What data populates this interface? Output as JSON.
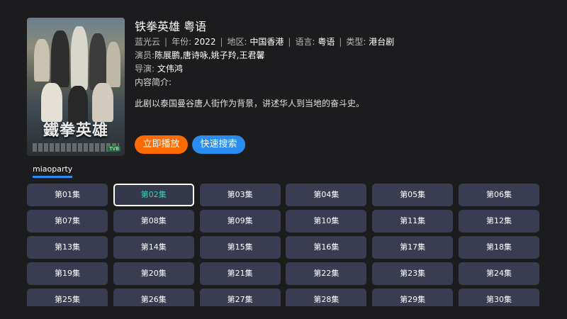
{
  "show": {
    "title": "铁拳英雄 粤语",
    "poster_title": "鐵拳英雄",
    "source_name": "蓝光云",
    "year_label": "年份:",
    "year": "2022",
    "region_label": "地区:",
    "region": "中国香港",
    "language_label": "语言:",
    "language": "粤语",
    "type_label": "类型:",
    "type": "港台剧",
    "cast_label": "演员:",
    "cast": "陈展鹏,唐诗咏,姚子羚,王君馨",
    "director_label": "导演:",
    "director": "文伟鸿",
    "intro_label": "内容简介:",
    "intro": "此剧以泰国曼谷唐人街作为背景，讲述华人到当地的奋斗史。",
    "badge": "TVB"
  },
  "actions": {
    "play_label": "立即播放",
    "search_label": "快速搜索"
  },
  "source_tab": {
    "label": "miaoparty"
  },
  "selected_episode": "第02集",
  "episodes": [
    "第01集",
    "第02集",
    "第03集",
    "第04集",
    "第05集",
    "第06集",
    "第07集",
    "第08集",
    "第09集",
    "第10集",
    "第11集",
    "第12集",
    "第13集",
    "第14集",
    "第15集",
    "第16集",
    "第17集",
    "第18集",
    "第19集",
    "第20集",
    "第21集",
    "第22集",
    "第23集",
    "第24集",
    "第25集",
    "第26集",
    "第27集",
    "第28集",
    "第29集",
    "第30集"
  ],
  "colors": {
    "background": "#1c1c1e",
    "play_button": "#ff6a00",
    "search_button": "#2a8cf0",
    "episode_tile": "#3a3d52",
    "selected_text": "#36d1b8"
  }
}
